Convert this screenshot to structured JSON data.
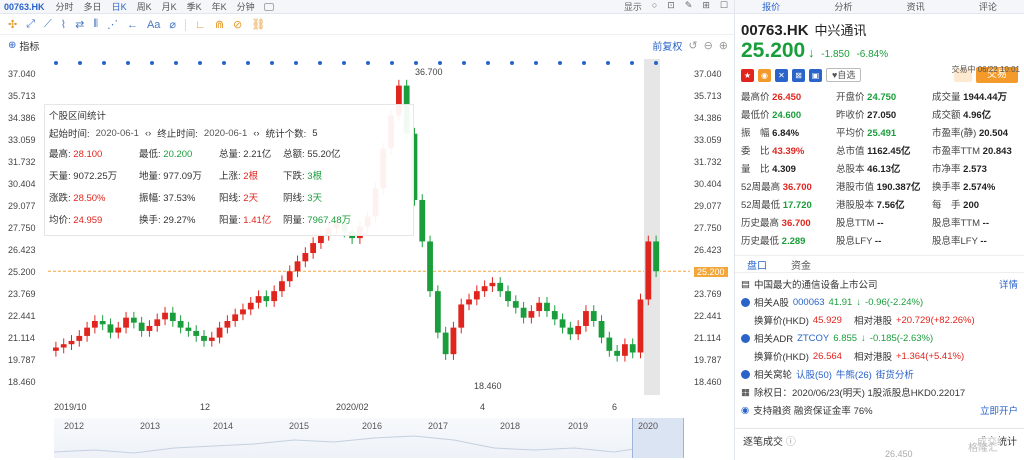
{
  "topbar": {
    "code": "00763.HK",
    "tabs": [
      "分时",
      "多日",
      "日K",
      "周K",
      "月K",
      "季K",
      "年K",
      "分钟"
    ],
    "active_tab": "日K",
    "right": [
      "显示",
      "○",
      "⊡",
      "✎",
      "⊞",
      "☐"
    ]
  },
  "toolbar": {
    "tools": [
      "✣",
      "⤢",
      "⟋",
      "⌇",
      "⇄",
      "⫴",
      "⋰",
      "←",
      "Aa",
      "⌀",
      "∟",
      "⋒",
      "⊘",
      "⛓"
    ]
  },
  "indicator": {
    "label": "指标",
    "adjust": "前复权"
  },
  "chart": {
    "y_ticks": [
      "37.040",
      "35.713",
      "34.386",
      "33.059",
      "31.732",
      "30.404",
      "29.077",
      "27.750",
      "26.423",
      "25.200",
      "23.769",
      "22.441",
      "21.114",
      "19.787",
      "18.460"
    ],
    "current_price": "25.200",
    "high_label": "36.700",
    "low_label": "18.460",
    "x_labels": [
      "2019/10",
      "12",
      "2020/02",
      "4",
      "6"
    ],
    "timeline_years": [
      "2012",
      "2013",
      "2014",
      "2015",
      "2016",
      "2017",
      "2018",
      "2019",
      "2020"
    ],
    "colors": {
      "up": "#e0251e",
      "down": "#1a9e3c",
      "price_line": "#f3a63a",
      "accent": "#2a63c9"
    }
  },
  "chart_data": {
    "type": "candlestick",
    "symbol": "00763.HK",
    "ylim": [
      18.46,
      37.04
    ],
    "approx_close": [
      20.6,
      20.8,
      21.0,
      21.3,
      21.8,
      22.2,
      22.0,
      21.5,
      21.8,
      22.4,
      22.1,
      21.6,
      21.9,
      22.3,
      22.7,
      22.2,
      21.8,
      21.6,
      21.3,
      21.0,
      21.2,
      21.8,
      22.2,
      22.6,
      22.9,
      23.3,
      23.7,
      23.4,
      24.0,
      24.6,
      25.2,
      25.8,
      26.3,
      26.9,
      27.4,
      27.8,
      28.2,
      27.6,
      27.2,
      27.9,
      28.5,
      30.2,
      32.6,
      34.6,
      36.4,
      33.5,
      29.5,
      27.0,
      24.0,
      21.5,
      20.2,
      21.8,
      23.2,
      23.5,
      24.0,
      24.3,
      24.5,
      24.0,
      23.4,
      23.0,
      22.4,
      22.8,
      23.3,
      22.8,
      22.3,
      21.8,
      21.4,
      21.9,
      22.8,
      22.2,
      21.2,
      20.4,
      20.1,
      20.8,
      20.3,
      23.5,
      27.0,
      25.2
    ]
  },
  "popup": {
    "title": "个股区间统计",
    "start_label": "起始时间:",
    "start_value": "2020-06-1",
    "end_label": "终止时间:",
    "end_value": "2020-06-1",
    "count_label": "统计个数:",
    "count_value": "5",
    "rows": [
      [
        {
          "k": "最高:",
          "v": "28.100",
          "c": "red"
        },
        {
          "k": "最低:",
          "v": "20.200",
          "c": "grn"
        },
        {
          "k": "总量:",
          "v": "2.21亿",
          "c": "dk"
        },
        {
          "k": "总额:",
          "v": "55.20亿",
          "c": "dk"
        }
      ],
      [
        {
          "k": "天量:",
          "v": "9072.25万",
          "c": "dk"
        },
        {
          "k": "地量:",
          "v": "977.09万",
          "c": "dk"
        },
        {
          "k": "上涨:",
          "v": "2根",
          "c": "red"
        },
        {
          "k": "下跌:",
          "v": "3根",
          "c": "grn"
        }
      ],
      [
        {
          "k": "涨跌:",
          "v": "28.50%",
          "c": "red"
        },
        {
          "k": "振幅:",
          "v": "37.53%",
          "c": "dk"
        },
        {
          "k": "阳线:",
          "v": "2天",
          "c": "red"
        },
        {
          "k": "阴线:",
          "v": "3天",
          "c": "grn"
        }
      ],
      [
        {
          "k": "均价:",
          "v": "24.959",
          "c": "red"
        },
        {
          "k": "换手:",
          "v": "29.27%",
          "c": "dk"
        },
        {
          "k": "阳量:",
          "v": "1.41亿",
          "c": "red"
        },
        {
          "k": "阴量:",
          "v": "7967.48万",
          "c": "grn"
        }
      ]
    ]
  },
  "right_panel": {
    "tabs": [
      "报价",
      "分析",
      "资讯",
      "评论"
    ],
    "active_tab": "报价",
    "code": "00763.HK",
    "name_cn": "中兴通讯",
    "price": "25.200",
    "arrow": "↓",
    "change": "-1.850",
    "change_pct": "-6.84%",
    "trade_info": "交易中 06/22 10:01",
    "icon_badges": [
      {
        "t": "★",
        "c": "#e0251e"
      },
      {
        "t": "◉",
        "c": "#f39a2b"
      },
      {
        "t": "✕",
        "c": "#2a63c9"
      },
      {
        "t": "⊠",
        "c": "#2a63c9"
      },
      {
        "t": "▣",
        "c": "#2a63c9"
      }
    ],
    "watch_label": "♥自选",
    "trade_label": "交易",
    "quote": [
      [
        {
          "k": "最高价",
          "v": "26.450",
          "c": "r"
        },
        {
          "k": "开盘价",
          "v": "24.750",
          "c": "g"
        },
        {
          "k": "成交量",
          "v": "1944.44万",
          "c": "d"
        }
      ],
      [
        {
          "k": "最低价",
          "v": "24.600",
          "c": "g"
        },
        {
          "k": "昨收价",
          "v": "27.050",
          "c": "d"
        },
        {
          "k": "成交额",
          "v": "4.96亿",
          "c": "d"
        }
      ],
      [
        {
          "k": "振　幅",
          "v": "6.84%",
          "c": "d"
        },
        {
          "k": "平均价",
          "v": "25.491",
          "c": "g"
        },
        {
          "k": "市盈率(静)",
          "v": "20.504",
          "c": "d"
        }
      ],
      [
        {
          "k": "委　比",
          "v": "43.39%",
          "c": "r"
        },
        {
          "k": "总市值",
          "v": "1162.45亿",
          "c": "d"
        },
        {
          "k": "市盈率TTM",
          "v": "20.843",
          "c": "d"
        }
      ],
      [
        {
          "k": "量　比",
          "v": "4.309",
          "c": "d"
        },
        {
          "k": "总股本",
          "v": "46.13亿",
          "c": "d"
        },
        {
          "k": "市净率",
          "v": "2.573",
          "c": "d"
        }
      ],
      [
        {
          "k": "52周最高",
          "v": "36.700",
          "c": "r"
        },
        {
          "k": "港股市值",
          "v": "190.387亿",
          "c": "d"
        },
        {
          "k": "换手率",
          "v": "2.574%",
          "c": "d"
        }
      ],
      [
        {
          "k": "52周最低",
          "v": "17.720",
          "c": "g"
        },
        {
          "k": "港股股本",
          "v": "7.56亿",
          "c": "d"
        },
        {
          "k": "每　手",
          "v": "200",
          "c": "d"
        }
      ],
      [
        {
          "k": "历史最高",
          "v": "36.700",
          "c": "r"
        },
        {
          "k": "股息TTM",
          "v": "--",
          "c": "d"
        },
        {
          "k": "股息率TTM",
          "v": "--",
          "c": "d"
        }
      ],
      [
        {
          "k": "历史最低",
          "v": "2.289",
          "c": "g"
        },
        {
          "k": "股息LFY",
          "v": "--",
          "c": "d"
        },
        {
          "k": "股息率LFY",
          "v": "--",
          "c": "d"
        }
      ]
    ],
    "sub_tabs": [
      "盘口",
      "资金"
    ],
    "active_sub": "盘口",
    "profile": "中国最大的通信设备上市公司",
    "detail": "详情",
    "a_share_label": "相关A股",
    "a_share_code": "000063",
    "a_share_price": "41.91",
    "a_share_arrow": "↓",
    "a_share_chg": "-0.96(-2.24%)",
    "a_conv_label": "换算价(HKD)",
    "a_conv_value": "45.929",
    "a_prem_label": "相对港股",
    "a_prem_value": "+20.729(+82.26%)",
    "adr_label": "相关ADR",
    "adr_code": "ZTCOY",
    "adr_price": "6.855",
    "adr_arrow": "↓",
    "adr_chg": "-0.185(-2.63%)",
    "adr_conv_label": "换算价(HKD)",
    "adr_conv_value": "26.564",
    "adr_prem_label": "相对港股",
    "adr_prem_value": "+1.364(+5.41%)",
    "war_label": "相关窝轮",
    "war_call": "认股(50)",
    "war_bull": "牛熊(26)",
    "war_analysis": "街货分析",
    "div_text": "除权日：2020/06/23(明天) 1股派股息HKD0.22017",
    "margin_text": "支持融资 融资保证金率 76%",
    "open_account": "立即开户",
    "bottom_left": "逐笔成交",
    "bottom_right": "成交统计",
    "bottom_price": "26.450"
  },
  "watermark": "格隆汇"
}
